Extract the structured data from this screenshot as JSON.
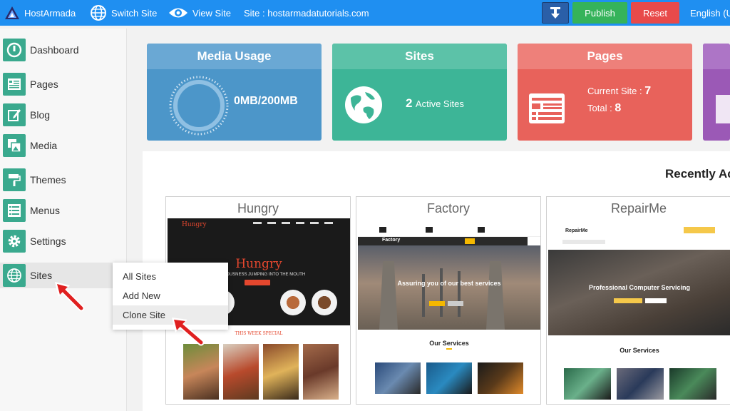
{
  "topbar": {
    "brand": "HostArmada",
    "switch_site": "Switch Site",
    "view_site": "View Site",
    "site_label": "Site : hostarmadatutorials.com",
    "publish": "Publish",
    "reset": "Reset",
    "language": "English (U"
  },
  "sidebar": {
    "items": [
      {
        "label": "Dashboard",
        "icon": "dashboard-icon"
      },
      {
        "label": "Pages",
        "icon": "pages-icon"
      },
      {
        "label": "Blog",
        "icon": "blog-edit-icon"
      },
      {
        "label": "Media",
        "icon": "media-icon"
      },
      {
        "label": "Themes",
        "icon": "paint-roller-icon"
      },
      {
        "label": "Menus",
        "icon": "menu-list-icon"
      },
      {
        "label": "Settings",
        "icon": "gear-icon"
      },
      {
        "label": "Sites",
        "icon": "globe-icon"
      }
    ]
  },
  "sites_menu": [
    "All Sites",
    "Add New",
    "Clone Site"
  ],
  "cards": {
    "media": {
      "title": "Media Usage",
      "value": "0MB/200MB",
      "color": "#4c96c9",
      "header_color": "#6aa8d4"
    },
    "sites": {
      "title": "Sites",
      "count": "2",
      "label": "Active Sites",
      "color": "#3db597",
      "header_color": "#5cc2a8"
    },
    "pages": {
      "title": "Pages",
      "current_label": "Current Site :",
      "current_value": "7",
      "total_label": "Total :",
      "total_value": "8",
      "color": "#e8625b",
      "header_color": "#ee807a"
    }
  },
  "recent": {
    "heading": "Recently Ac",
    "sites": [
      {
        "name": "Hungry",
        "hero": "Hungry",
        "tagline": "DELICIOUSNESS JUMPING INTO THE MOUTH",
        "section": "THIS WEEK SPECIAL"
      },
      {
        "name": "Factory",
        "hero": "Assuring you of our best services",
        "section": "Our Services",
        "brand": "Factory"
      },
      {
        "name": "RepairMe",
        "hero": "Professional Computer Servicing",
        "section": "Our Services",
        "brand": "RepairMe"
      }
    ]
  }
}
